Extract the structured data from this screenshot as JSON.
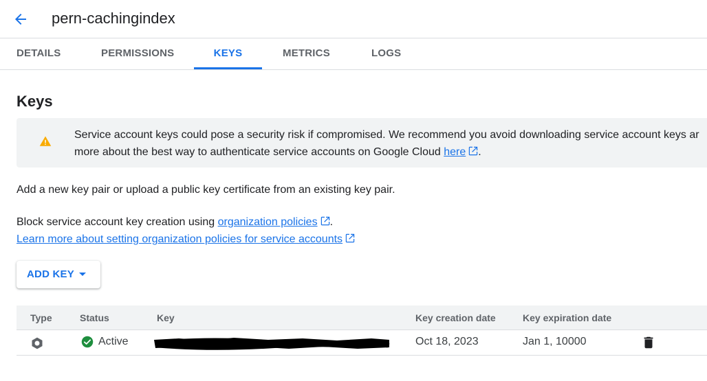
{
  "header": {
    "title": "pern-cachingindex",
    "back_icon": "arrow-back-icon"
  },
  "tabs": [
    {
      "label": "DETAILS"
    },
    {
      "label": "PERMISSIONS"
    },
    {
      "label": "KEYS",
      "active": true
    },
    {
      "label": "METRICS"
    },
    {
      "label": "LOGS"
    }
  ],
  "section": {
    "title": "Keys"
  },
  "warning": {
    "line1": "Service account keys could pose a security risk if compromised. We recommend you avoid downloading service account keys ar",
    "line2_prefix": "more about the best way to authenticate service accounts on Google Cloud ",
    "line2_link": "here",
    "line2_suffix": "."
  },
  "intro": "Add a new key pair or upload a public key certificate from an existing key pair.",
  "policy": {
    "prefix": "Block service account key creation using ",
    "link": "organization policies",
    "suffix": ".",
    "learn_more": "Learn more about setting organization policies for service accounts"
  },
  "add_key_button": {
    "label": "ADD KEY"
  },
  "table": {
    "columns": [
      "Type",
      "Status",
      "Key",
      "Key creation date",
      "Key expiration date"
    ],
    "rows": [
      {
        "status": "Active",
        "creation_date": "Oct 18, 2023",
        "expiration_date": "Jan 1, 10000"
      }
    ]
  },
  "colors": {
    "accent": "#1a73e8",
    "warning": "#f9ab00",
    "success": "#1e8e3e"
  }
}
